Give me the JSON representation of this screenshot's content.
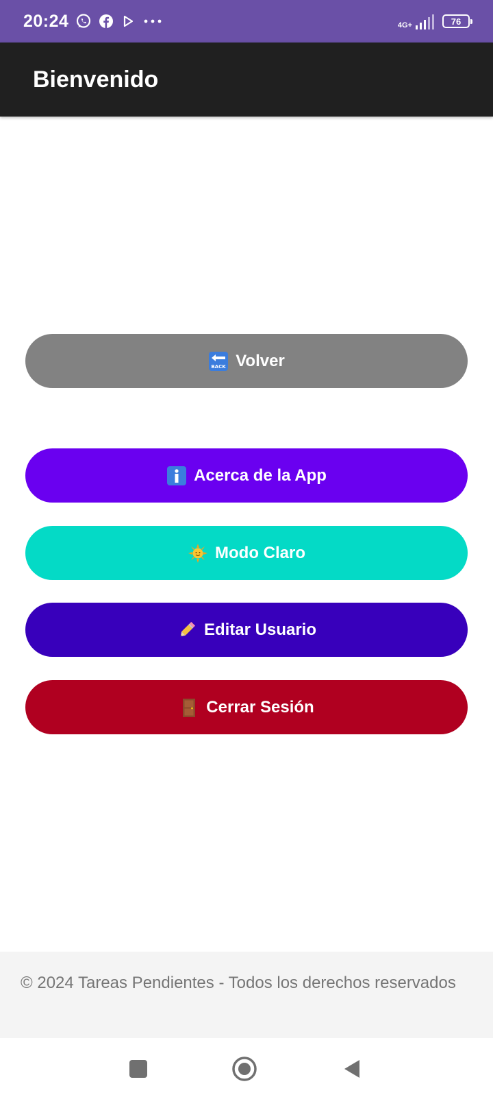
{
  "status_bar": {
    "time": "20:24",
    "notification_icons": [
      "whatsapp-icon",
      "facebook-icon",
      "play-store-icon",
      "more-dots-icon"
    ],
    "network": "4G+",
    "battery": "76",
    "background_color": "#6a50a7"
  },
  "app_bar": {
    "title": "Bienvenido",
    "background_color": "#202020"
  },
  "buttons": {
    "back": {
      "label": "Volver",
      "icon": "back-arrow-icon",
      "color": "#828282"
    },
    "about": {
      "label": "Acerca de la App",
      "icon": "info-icon",
      "color": "#6a00f0"
    },
    "light_mode": {
      "label": "Modo Claro",
      "icon": "sun-icon",
      "color": "#04dac6"
    },
    "edit_user": {
      "label": "Editar Usuario",
      "icon": "pencil-icon",
      "color": "#3800bb"
    },
    "logout": {
      "label": "Cerrar Sesión",
      "icon": "door-icon",
      "color": "#b00020"
    }
  },
  "footer": {
    "text": "© 2024 Tareas Pendientes - Todos los derechos reservados"
  },
  "nav_bar": {
    "buttons": [
      "recents-square-icon",
      "home-circle-icon",
      "back-triangle-icon"
    ]
  }
}
